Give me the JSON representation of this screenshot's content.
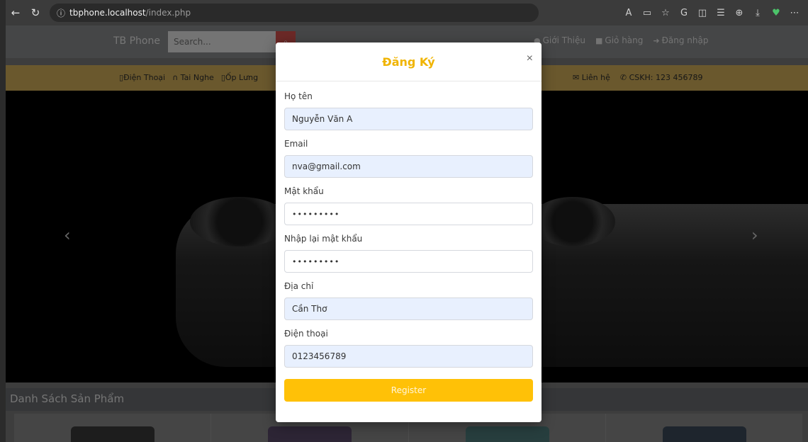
{
  "browser": {
    "url_host": "tbphone.localhost",
    "url_path": "/index.php"
  },
  "site": {
    "brand": "TB Phone",
    "search_placeholder": "Search...",
    "right_nav": [
      "Giới Thiệu",
      "Giỏ hàng",
      "Đăng nhập"
    ],
    "categories": [
      "Điện Thoại",
      "Tai Nghe",
      "Ốp Lưng"
    ],
    "contact_link": "Liên hệ",
    "hotline": "CSKH: 123 456789",
    "list_title": "Danh Sách Sản Phẩm"
  },
  "modal": {
    "title": "Đăng Ký",
    "close_label": "×",
    "fields": [
      {
        "label": "Họ tên",
        "value": "Nguyễn Văn A"
      },
      {
        "label": "Email",
        "value": "nva@gmail.com"
      },
      {
        "label": "Mật khẩu",
        "value": "•••••••••"
      },
      {
        "label": "Nhập lại mật khẩu",
        "value": "•••••••••"
      },
      {
        "label": "Địa chỉ",
        "value": "Cần Thơ"
      },
      {
        "label": "Điện thoại",
        "value": "0123456789"
      }
    ],
    "register_label": "Register"
  },
  "colors": {
    "accent": "#ffc107",
    "title": "#f0b400",
    "autofill": "#e8f0fe"
  }
}
